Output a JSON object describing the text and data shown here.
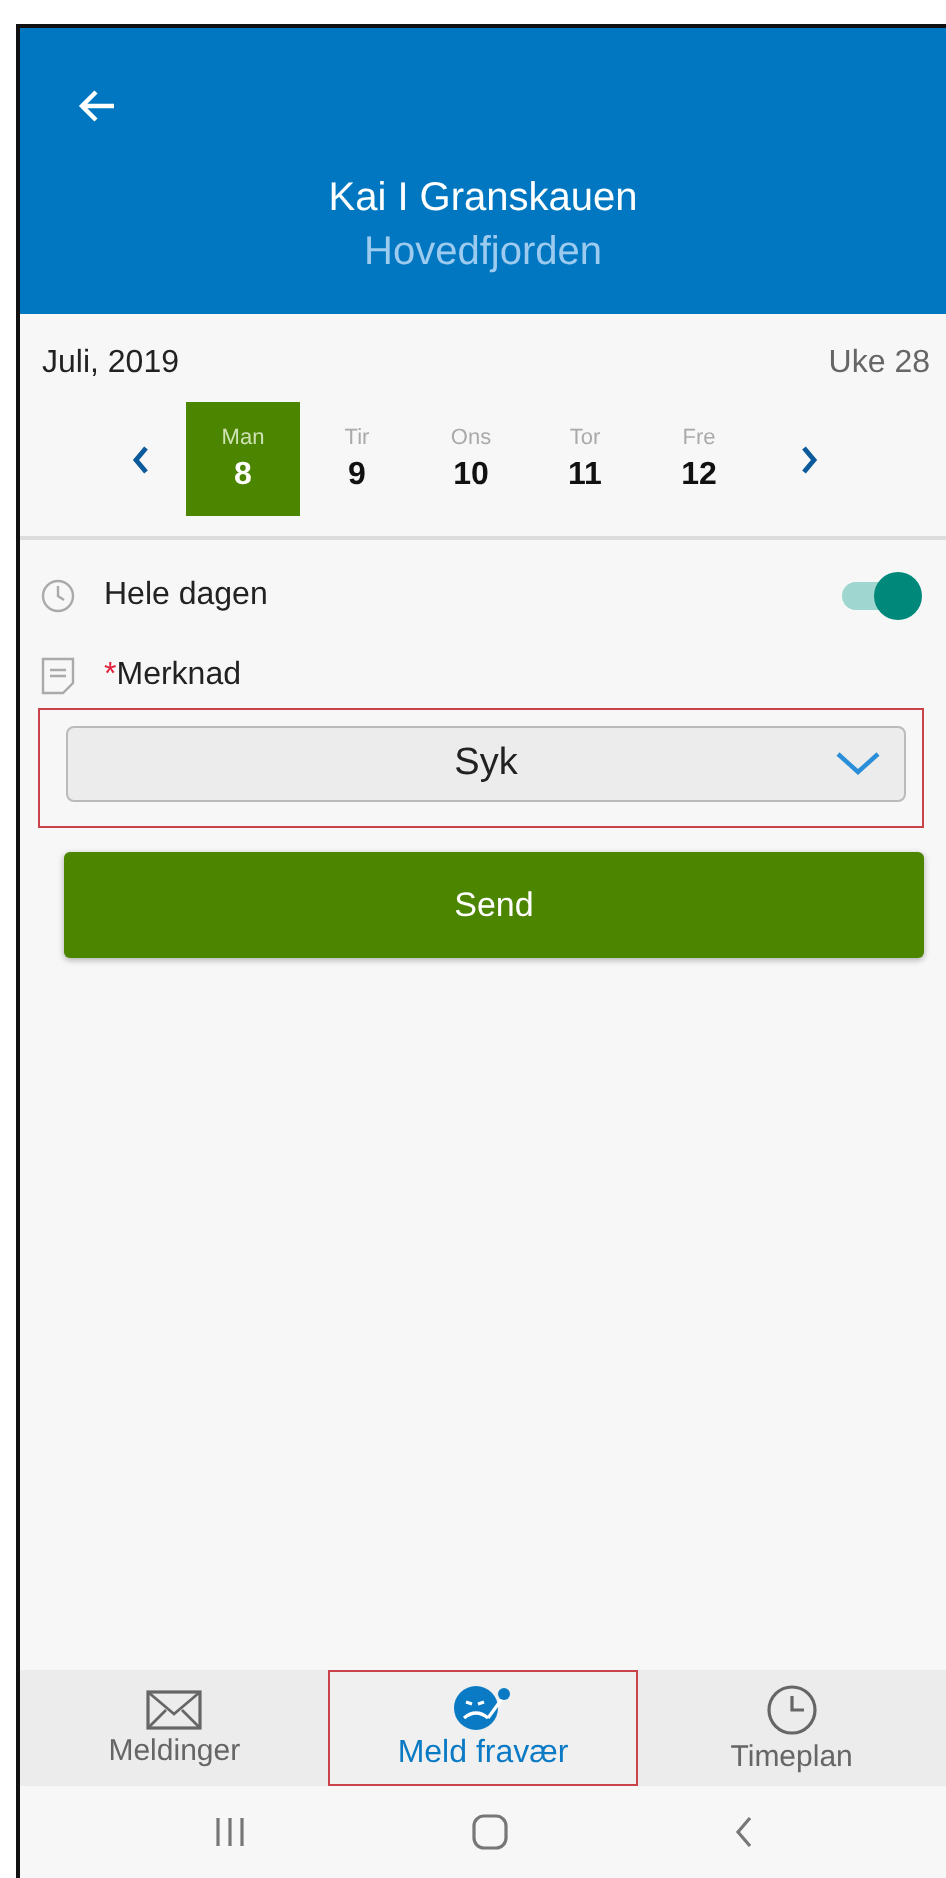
{
  "header": {
    "title": "Kai I Granskauen",
    "subtitle": "Hovedfjorden"
  },
  "calendar": {
    "month": "Juli, 2019",
    "week": "Uke 28",
    "days": [
      {
        "weekday": "Man",
        "date": "8",
        "selected": true
      },
      {
        "weekday": "Tir",
        "date": "9",
        "selected": false
      },
      {
        "weekday": "Ons",
        "date": "10",
        "selected": false
      },
      {
        "weekday": "Tor",
        "date": "11",
        "selected": false
      },
      {
        "weekday": "Fre",
        "date": "12",
        "selected": false
      }
    ]
  },
  "all_day": {
    "label": "Hele dagen",
    "on": true
  },
  "remark": {
    "required_mark": "*",
    "label": "Merknad",
    "value": "Syk",
    "highlighted": true
  },
  "send_button": "Send",
  "tabs": [
    {
      "kind": "mail",
      "label": "Meldinger",
      "selected": false,
      "highlighted": false
    },
    {
      "kind": "absence",
      "label": "Meld fravær",
      "selected": true,
      "highlighted": true
    },
    {
      "kind": "clock",
      "label": "Timeplan",
      "selected": false,
      "highlighted": false
    }
  ]
}
